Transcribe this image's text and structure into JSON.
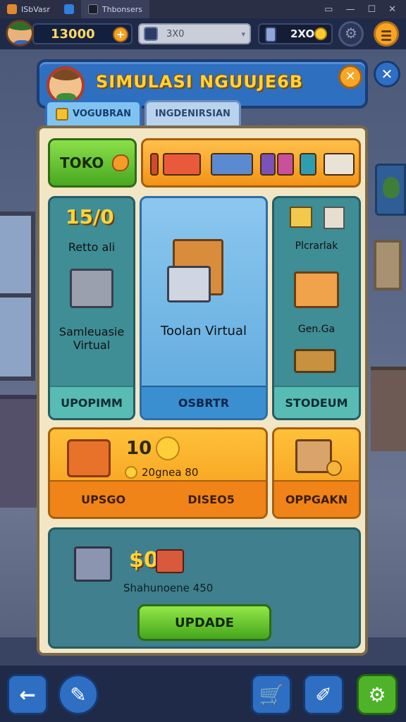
{
  "os": {
    "tabs": [
      {
        "label": "ISbVasr"
      },
      {
        "label": ""
      },
      {
        "label": "Thbonsers"
      }
    ],
    "controls": [
      "▭",
      "—",
      "☐",
      "✕"
    ]
  },
  "hud": {
    "coins": "13000",
    "coins_plus": "+",
    "search_value": "3X0",
    "gems": "2XO",
    "settings_glyph": "⚙"
  },
  "panel": {
    "title": "SIMULASI NGUUJE6B",
    "close_glyph": "✕",
    "tabs": [
      "VOGUBRAN",
      "INGDENIRSIAN"
    ]
  },
  "topbar": {
    "toko_label": "TOKO"
  },
  "cards": {
    "left": {
      "big": "15/0",
      "title": "Retto ali",
      "desc": "Samleuasie Virtual",
      "footer": "UPOPIMM"
    },
    "center": {
      "title": "Toolan Virtual",
      "footer": "OSBRTR"
    },
    "right": {
      "title": "Plcrarlak",
      "sub": "Gen.Ga",
      "footer": "STODEUM"
    },
    "orange_left": {
      "big": "10",
      "line": "20gnea 80",
      "footer_left": "UPSGO",
      "footer_right": "DISEO5"
    },
    "orange_right": {
      "footer": "OPPGAKN"
    },
    "bottom": {
      "big": "$0",
      "line": "Shahunoene 450",
      "button": "UPDADE"
    }
  },
  "nav": {
    "back": "←",
    "edit": "✎",
    "cart": "🛒",
    "marker": "✐",
    "settings": "⚙"
  },
  "colors": {
    "accent_blue": "#2e6fc4",
    "accent_orange": "#f39317",
    "accent_green": "#4fb32a",
    "panel_cream": "#f2e6c4"
  }
}
